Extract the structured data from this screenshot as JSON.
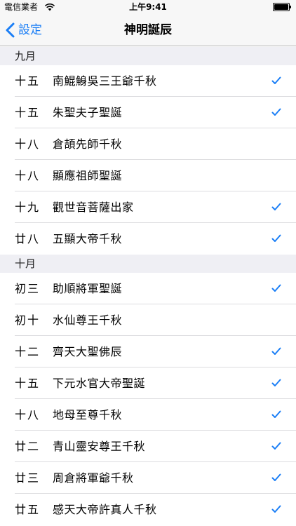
{
  "status_bar": {
    "carrier": "電信業者",
    "time": "上午9:41"
  },
  "nav": {
    "back_label": "設定",
    "title": "神明誕辰"
  },
  "accent_color": "#1a7ef6",
  "sections": [
    {
      "header": "九月",
      "rows": [
        {
          "date": "十五",
          "name": "南鯤鯓吳三王爺千秋",
          "checked": true
        },
        {
          "date": "十五",
          "name": "朱聖夫子聖誕",
          "checked": true
        },
        {
          "date": "十八",
          "name": "倉頡先師千秋",
          "checked": false
        },
        {
          "date": "十八",
          "name": "顯應祖師聖誕",
          "checked": false
        },
        {
          "date": "十九",
          "name": "觀世音菩薩出家",
          "checked": true
        },
        {
          "date": "廿八",
          "name": "五顯大帝千秋",
          "checked": true
        }
      ]
    },
    {
      "header": "十月",
      "rows": [
        {
          "date": "初三",
          "name": "助順將軍聖誕",
          "checked": true
        },
        {
          "date": "初十",
          "name": "水仙尊王千秋",
          "checked": false
        },
        {
          "date": "十二",
          "name": "齊天大聖佛辰",
          "checked": true
        },
        {
          "date": "十五",
          "name": "下元水官大帝聖誕",
          "checked": true
        },
        {
          "date": "十八",
          "name": "地母至尊千秋",
          "checked": true
        },
        {
          "date": "廿二",
          "name": "青山靈安尊王千秋",
          "checked": true
        },
        {
          "date": "廿三",
          "name": "周倉將軍爺千秋",
          "checked": true
        },
        {
          "date": "廿五",
          "name": "感天大帝許真人千秋",
          "checked": true
        }
      ]
    }
  ]
}
